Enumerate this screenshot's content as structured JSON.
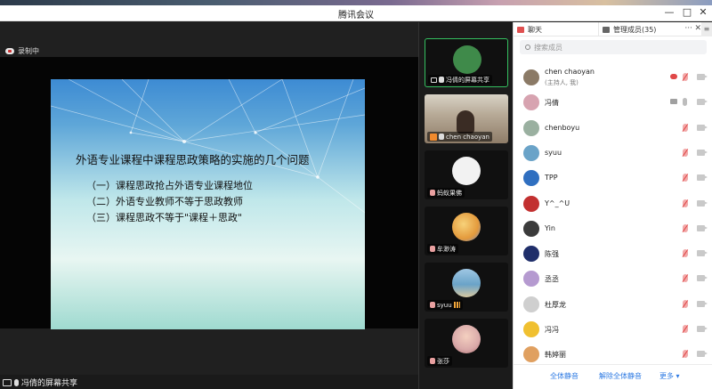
{
  "window": {
    "title": "腾讯会议",
    "minimize": "—",
    "maximize": "□",
    "close": "✕"
  },
  "recording": {
    "label": "录制中"
  },
  "slide": {
    "heading": "外语专业课程中课程思政策略的实施的几个问题",
    "items": [
      "（一）课程思政抢占外语专业课程地位",
      "（二）外语专业教师不等于思政教师",
      "（三）课程思政不等于\"课程＋思政\""
    ]
  },
  "share_bar": {
    "label": "冯倩的屏幕共享"
  },
  "video_tiles": [
    {
      "name": "冯倩的屏幕共享",
      "avatar_color": "#3f8a4a",
      "active": true
    },
    {
      "name": "chen chaoyan",
      "avatar_color": "#8b7a66",
      "active": false
    },
    {
      "name": "蚂蚁果佛",
      "avatar_color": "#f2f2f2",
      "active": false
    },
    {
      "name": "牟渺涛",
      "avatar_color": "#e49a3c",
      "active": false
    },
    {
      "name": "syuu",
      "avatar_color": "#6aa3c8",
      "active": false
    },
    {
      "name": "张莎",
      "avatar_color": "#d9a9a9",
      "active": false
    }
  ],
  "panel": {
    "tab_chat": "聊天",
    "tab_members": "管理成员(35)",
    "more": "···",
    "close": "✕",
    "menu": "≡",
    "search_placeholder": "搜索成员",
    "members": [
      {
        "name": "chen chaoyan",
        "sub": "(主持人, 我)",
        "avatar_color": "#8b7a66",
        "status": "host"
      },
      {
        "name": "冯倩",
        "sub": "",
        "avatar_color": "#d7a3b0",
        "status": "sharing"
      },
      {
        "name": "chenboyu",
        "sub": "",
        "avatar_color": "#9ab0a0",
        "status": "muted"
      },
      {
        "name": "syuu",
        "sub": "",
        "avatar_color": "#6aa3c8",
        "status": "muted"
      },
      {
        "name": "TPP",
        "sub": "",
        "avatar_color": "#2f6fc0",
        "status": "muted"
      },
      {
        "name": "Y^_^U",
        "sub": "",
        "avatar_color": "#c23030",
        "status": "muted"
      },
      {
        "name": "Yin",
        "sub": "",
        "avatar_color": "#3b3b3b",
        "status": "muted"
      },
      {
        "name": "陈强",
        "sub": "",
        "avatar_color": "#1f2e6a",
        "status": "muted"
      },
      {
        "name": "丞丞",
        "sub": "",
        "avatar_color": "#b59ad0",
        "status": "muted"
      },
      {
        "name": "杜厚龙",
        "sub": "",
        "avatar_color": "#cfcfcf",
        "status": "muted"
      },
      {
        "name": "冯冯",
        "sub": "",
        "avatar_color": "#f0c030",
        "status": "muted"
      },
      {
        "name": "韩婷丽",
        "sub": "",
        "avatar_color": "#e0a060",
        "status": "muted"
      }
    ],
    "footer": {
      "mute_all": "全体静音",
      "unmute_all": "解除全体静音",
      "more": "更多 ▾"
    }
  },
  "colors": {
    "accent_blue": "#2f7be3",
    "active_green": "#34c060",
    "mute_red": "#e04848"
  }
}
